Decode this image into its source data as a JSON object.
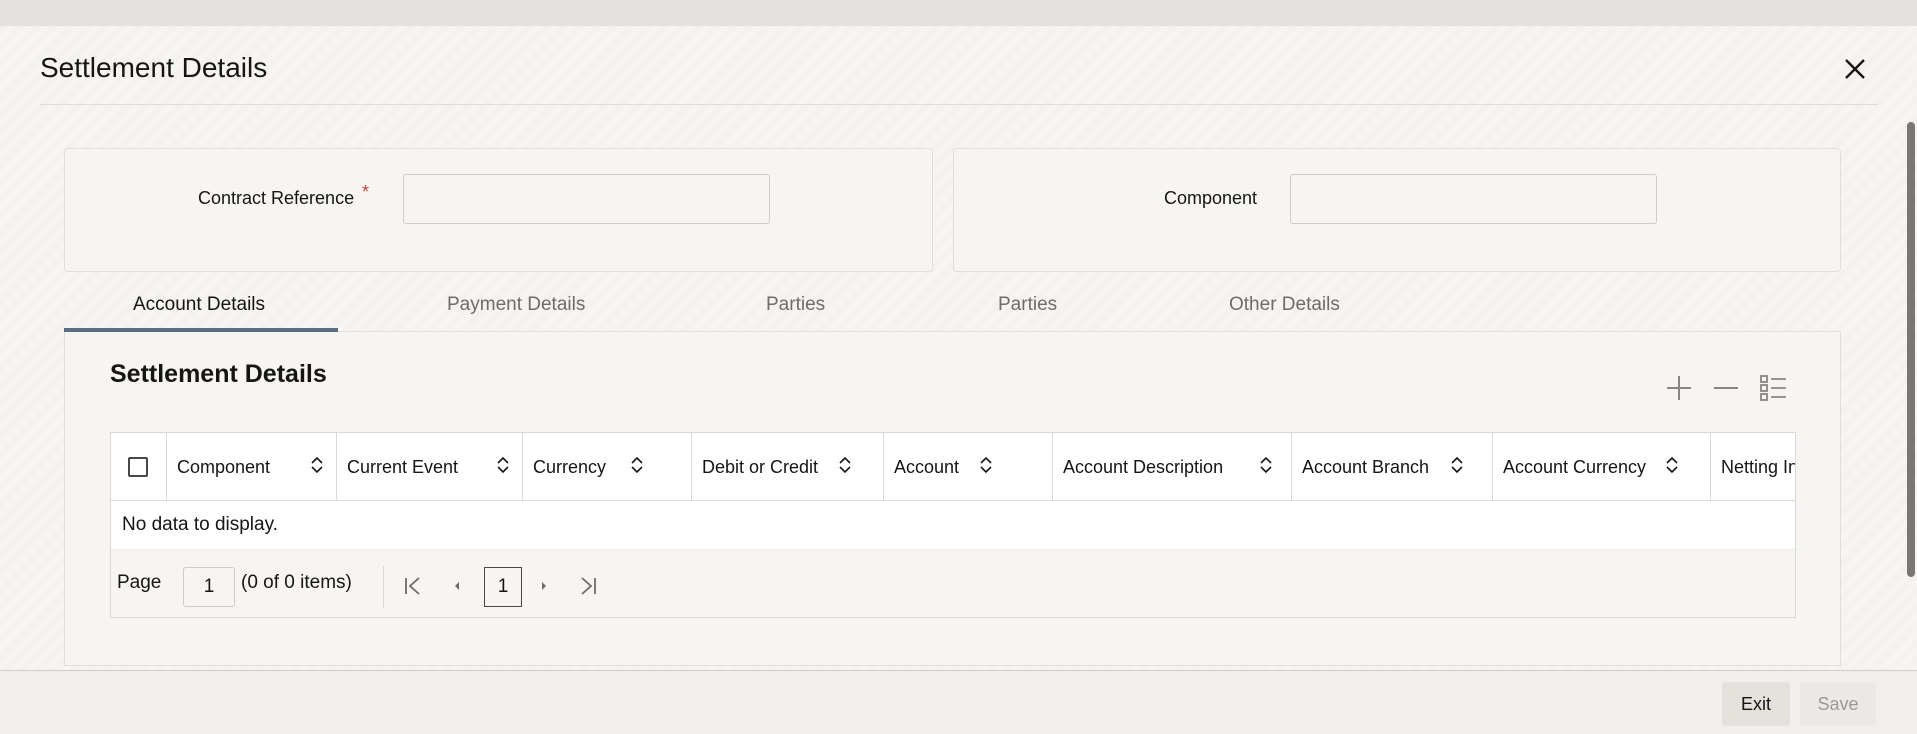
{
  "dialog": {
    "title": "Settlement Details"
  },
  "form": {
    "contract_reference": {
      "label": "Contract Reference",
      "required_mark": "*",
      "value": ""
    },
    "component": {
      "label": "Component",
      "value": ""
    }
  },
  "tabs": [
    {
      "label": "Account Details",
      "active": true
    },
    {
      "label": "Payment Details",
      "active": false
    },
    {
      "label": "Parties",
      "active": false
    },
    {
      "label": "Parties",
      "active": false
    },
    {
      "label": "Other Details",
      "active": false
    }
  ],
  "section": {
    "title": "Settlement Details",
    "tools": [
      "add-icon",
      "remove-icon",
      "list-view-icon"
    ]
  },
  "grid": {
    "columns": [
      "Component",
      "Current Event",
      "Currency",
      "Debit or Credit",
      "Account",
      "Account Description",
      "Account Branch",
      "Account Currency",
      "Netting In"
    ],
    "rows": [],
    "empty_text": "No data to display."
  },
  "pager": {
    "page_label": "Page",
    "page_value": "1",
    "items_text": "(0 of 0 items)",
    "current_page": "1"
  },
  "footer": {
    "exit_label": "Exit",
    "save_label": "Save"
  },
  "colors": {
    "accent_underline": "#5a6e83",
    "required": "#c74634"
  }
}
